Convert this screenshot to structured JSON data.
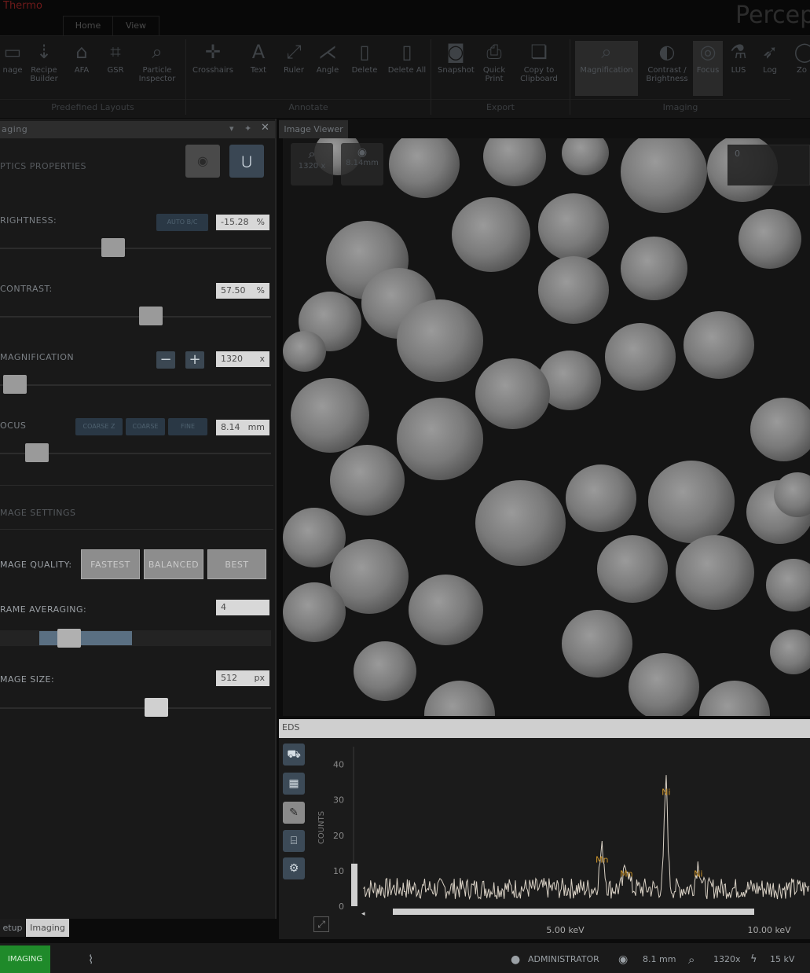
{
  "titlebar": {
    "brand": "Thermo",
    "brand_sub": "",
    "app_title": "Percep",
    "menu_tabs": [
      "Home",
      "View"
    ]
  },
  "ribbon": {
    "buttons": [
      {
        "label": "nage",
        "icon": "layout-icon"
      },
      {
        "label": "Recipe\nBuilder",
        "icon": "recipe-icon"
      },
      {
        "label": "AFA",
        "icon": "afa-icon"
      },
      {
        "label": "GSR",
        "icon": "gsr-icon"
      },
      {
        "label": "Particle\nInspector",
        "icon": "magnifier-icon"
      },
      {
        "label": "Crosshairs",
        "icon": "crosshairs-icon"
      },
      {
        "label": "Text",
        "icon": "text-icon"
      },
      {
        "label": "Ruler",
        "icon": "ruler-icon"
      },
      {
        "label": "Angle",
        "icon": "angle-icon"
      },
      {
        "label": "Delete",
        "icon": "trash-icon"
      },
      {
        "label": "Delete All",
        "icon": "trash-all-icon"
      },
      {
        "label": "Snapshot",
        "icon": "camera-icon"
      },
      {
        "label": "Quick\nPrint",
        "icon": "printer-icon"
      },
      {
        "label": "Copy to\nClipboard",
        "icon": "clipboard-icon"
      },
      {
        "label": "Magnification",
        "icon": "magnification-icon"
      },
      {
        "label": "Contrast /\nBrightness",
        "icon": "contrast-icon"
      },
      {
        "label": "Focus",
        "icon": "focus-icon"
      },
      {
        "label": "LUS",
        "icon": "flask-icon"
      },
      {
        "label": "Log",
        "icon": "log-icon"
      },
      {
        "label": "Zo",
        "icon": "zoom-icon"
      }
    ],
    "groups": [
      "Predefined Layouts",
      "Annotate",
      "Export",
      "Imaging"
    ]
  },
  "left_panel": {
    "title": "aging",
    "optics_section": "PTICS PROPERTIES",
    "brightness": {
      "label": "RIGHTNESS:",
      "auto_label": "AUTO B/C",
      "value": "-15.28",
      "unit": "%"
    },
    "contrast": {
      "label": "CONTRAST:",
      "value": "57.50",
      "unit": "%"
    },
    "magnification": {
      "label": "MAGNIFICATION",
      "minus": "−",
      "plus": "+",
      "value": "1320",
      "unit": "x"
    },
    "focus": {
      "label": "OCUS",
      "btn1": "COARSE Z",
      "btn2": "COARSE",
      "btn3": "FINE",
      "value": "8.14",
      "unit": "mm"
    },
    "image_section": "MAGE SETTINGS",
    "image_quality": {
      "label": "MAGE QUALITY:",
      "options": [
        "FASTEST",
        "BALANCED",
        "BEST"
      ]
    },
    "frame_averaging": {
      "label": "RAME AVERAGING:",
      "value": "4"
    },
    "image_size": {
      "label": "MAGE SIZE:",
      "value": "512",
      "unit": "px"
    },
    "bottom_tabs": [
      "etup",
      "Imaging"
    ]
  },
  "viewer": {
    "tab": "Image Viewer",
    "mag_readout": "1320 x",
    "wd_readout": "8.14mm",
    "overlay_value": "0"
  },
  "eds": {
    "title": "EDS",
    "chart_data": {
      "type": "line",
      "ylabel": "COUNTS",
      "yticks": [
        "0",
        "10",
        "20",
        "30",
        "40"
      ],
      "ylim": [
        0,
        45
      ],
      "xlim": [
        0,
        11
      ],
      "xticks": [
        "5.00 keV",
        "10.00 keV"
      ],
      "peaks": [
        {
          "label": "Mn",
          "x": 5.9,
          "y": 11
        },
        {
          "label": "Mn",
          "x": 6.5,
          "y": 7
        },
        {
          "label": "Ni",
          "x": 7.47,
          "y": 30
        },
        {
          "label": "Ni",
          "x": 8.26,
          "y": 7
        }
      ]
    }
  },
  "status": {
    "mode": "IMAGING",
    "user": "ADMINISTRATOR",
    "wd": "8.1 mm",
    "mag": "1320x",
    "kv": "15 kV"
  }
}
